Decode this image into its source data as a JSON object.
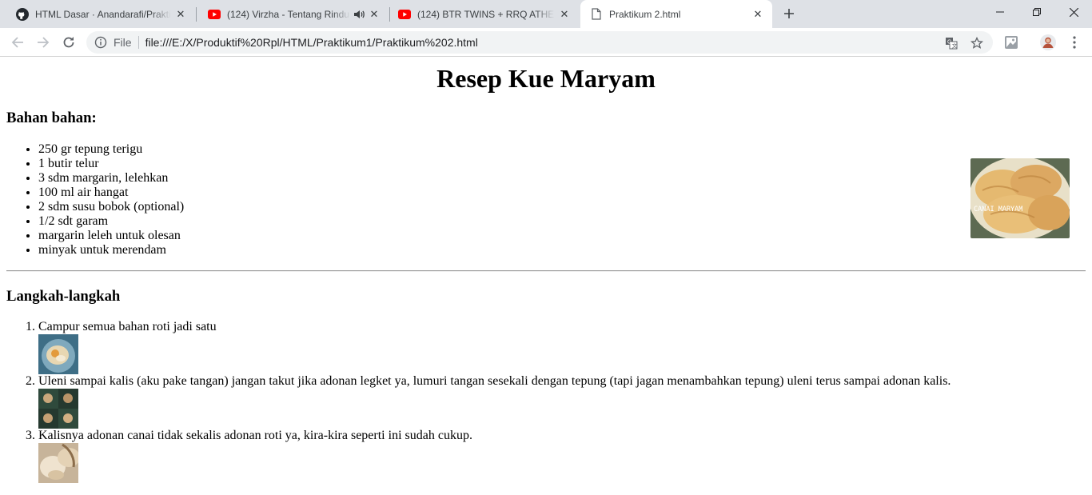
{
  "browser": {
    "tabs": [
      {
        "title": "HTML Dasar · Anandarafi/Praktikum",
        "favicon": "github-icon",
        "audio": false,
        "active": false
      },
      {
        "title": "(124) Virzha - Tentang Rindu",
        "favicon": "youtube-icon",
        "audio": true,
        "active": false
      },
      {
        "title": "(124) BTR TWINS + RRQ ATHENA",
        "favicon": "youtube-icon",
        "audio": false,
        "active": false
      },
      {
        "title": "Praktikum 2.html",
        "favicon": "document-icon",
        "audio": false,
        "active": true
      }
    ],
    "address": {
      "scheme_label": "File",
      "url": "file:///E:/X/Produktif%20Rpl/HTML/Praktikum1/Praktikum%202.html"
    },
    "colors": {
      "tabstrip": "#dee1e6",
      "youtube_red": "#ff0000"
    }
  },
  "page": {
    "title": "Resep Kue Maryam",
    "ingredients_heading": "Bahan bahan:",
    "ingredients": [
      "250 gr tepung terigu",
      "1 butir telur",
      "3 sdm margarin, lelehkan",
      "100 ml air hangat",
      "2 sdm susu bobok (optional)",
      "1/2 sdt garam",
      "margarin leleh untuk olesan",
      "minyak untuk merendam"
    ],
    "hero_image_caption": "CANAI MARYAM",
    "steps_heading": "Langkah-langkah",
    "steps": [
      "Campur semua bahan roti jadi satu",
      "Uleni sampai kalis (aku pake tangan) jangan takut jika adonan legket ya, lumuri tangan sesekali dengan tepung (tapi jagan menambahkan tepung) uleni terus sampai adonan kalis.",
      "Kalisnya adonan canai tidak sekalis adonan roti ya, kira-kira seperti ini sudah cukup."
    ]
  }
}
